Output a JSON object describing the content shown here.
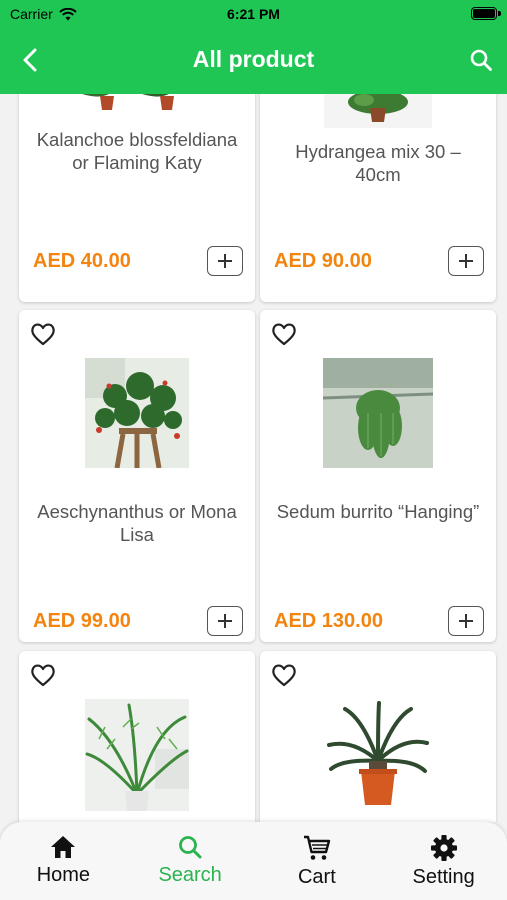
{
  "status": {
    "carrier": "Carrier",
    "time": "6:21 PM"
  },
  "header": {
    "title": "All product"
  },
  "colors": {
    "brand": "#1fc654",
    "price": "#f2840f",
    "active_tab": "#2bb34f"
  },
  "products": [
    {
      "name": "Kalanchoe blossfeldiana or Flaming Katy",
      "price": "AED 40.00"
    },
    {
      "name": "Hydrangea mix 30 – 40cm",
      "price": "AED 90.00"
    },
    {
      "name": "Aeschynanthus or Mona Lisa",
      "price": "AED 99.00"
    },
    {
      "name": "Sedum burrito “Hanging”",
      "price": "AED 130.00"
    },
    {
      "name": "",
      "price": ""
    },
    {
      "name": "",
      "price": ""
    }
  ],
  "tabs": [
    {
      "label": "Home",
      "icon": "home-icon"
    },
    {
      "label": "Search",
      "icon": "search-icon"
    },
    {
      "label": "Cart",
      "icon": "cart-icon"
    },
    {
      "label": "Setting",
      "icon": "gear-icon"
    }
  ]
}
